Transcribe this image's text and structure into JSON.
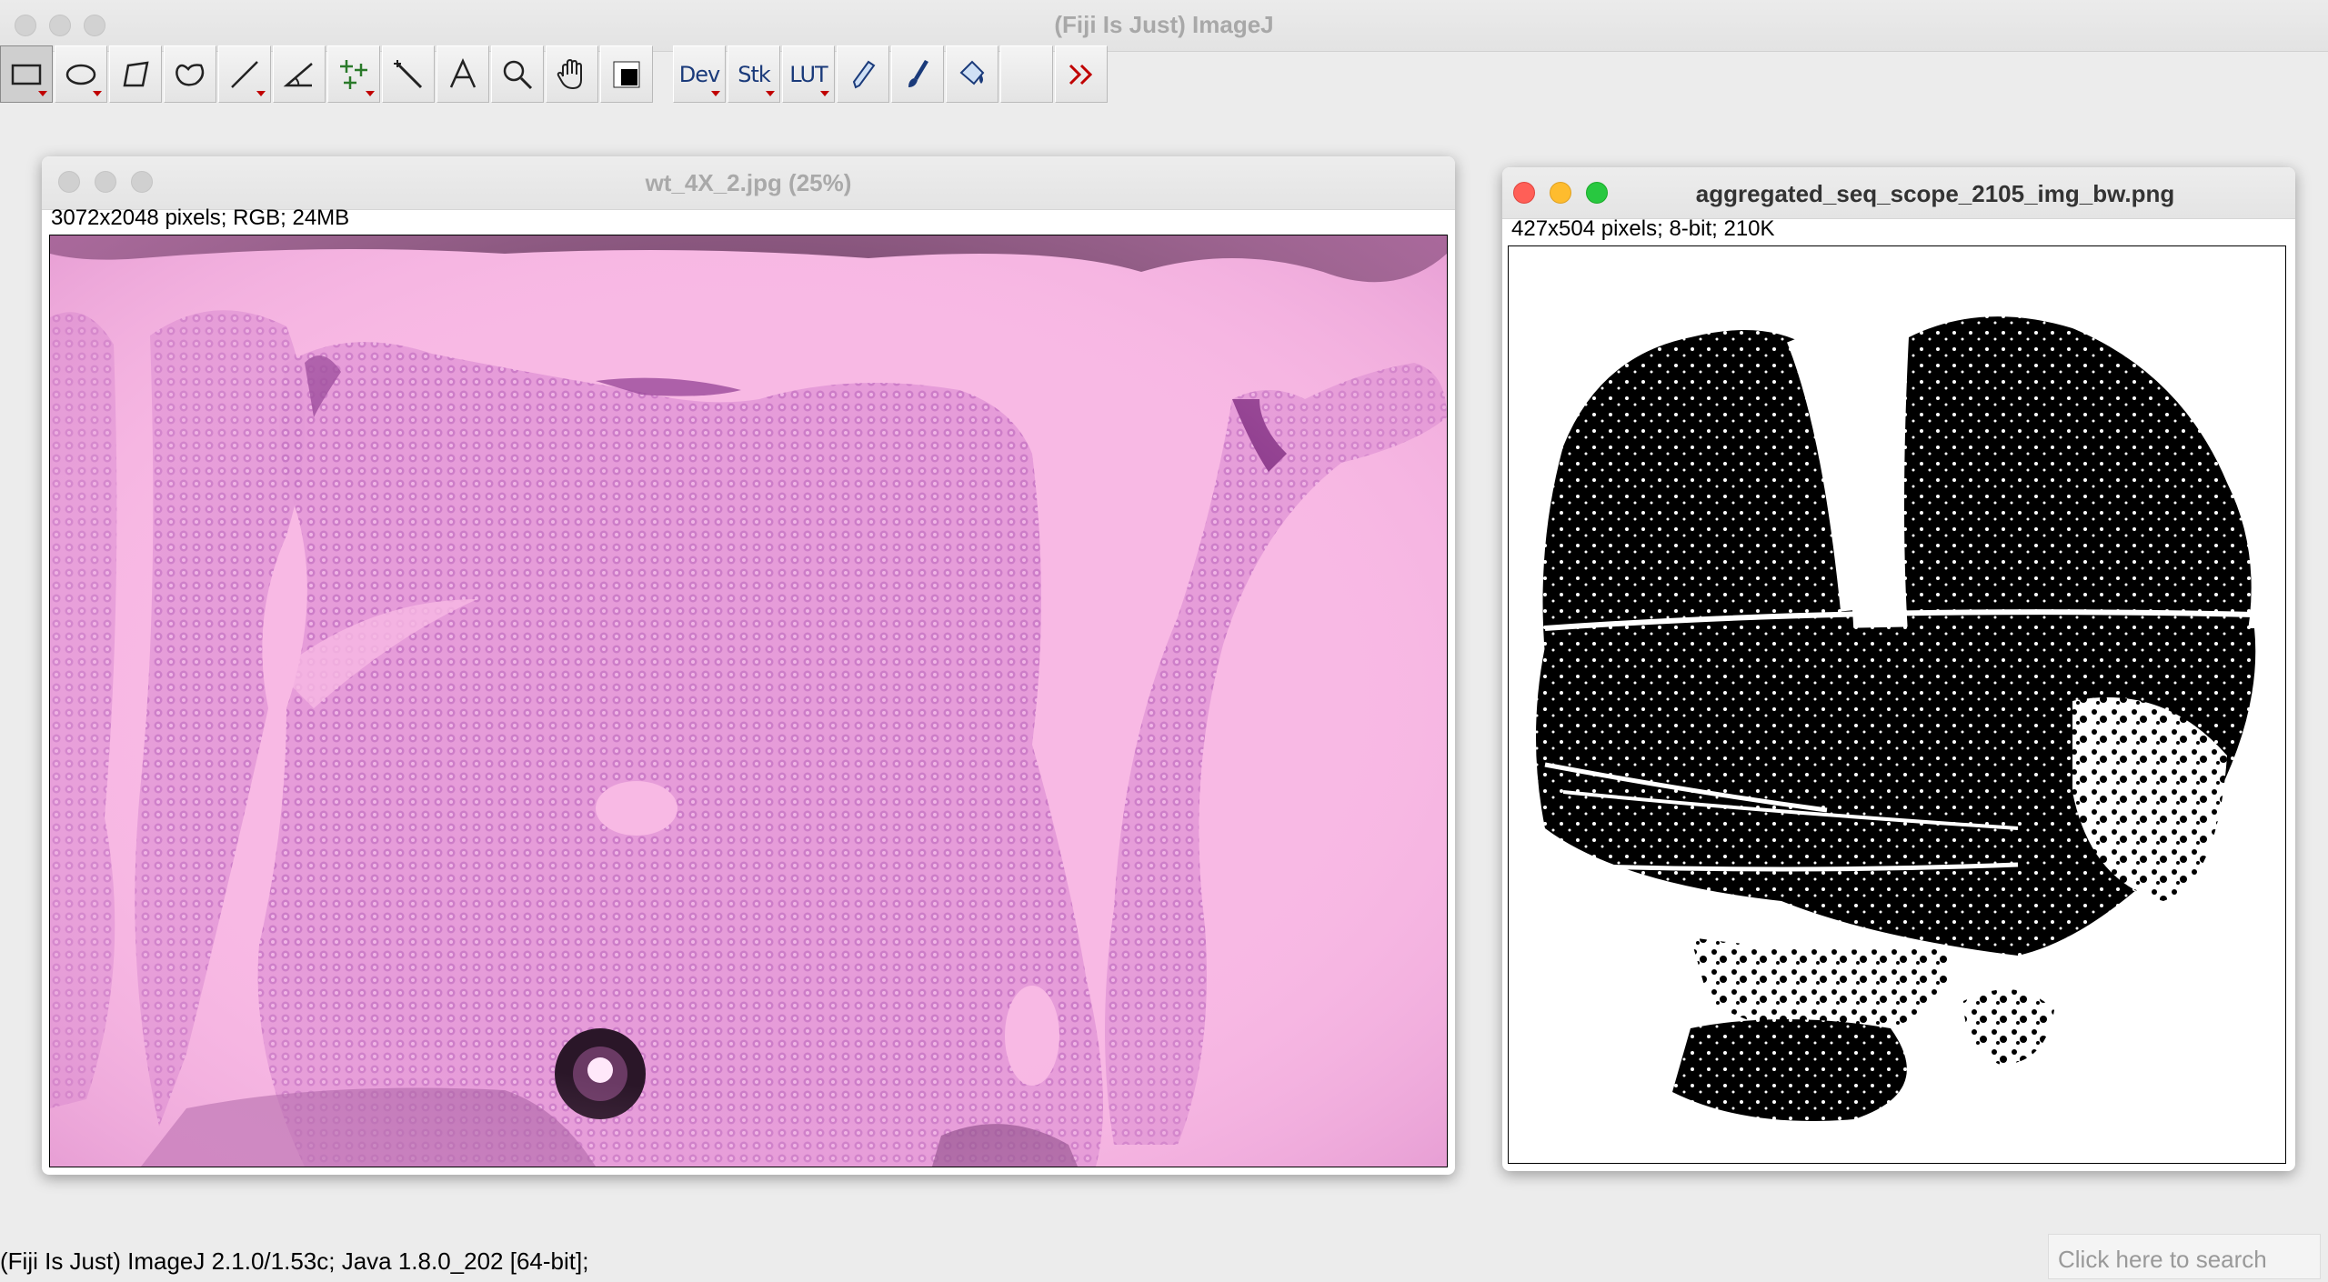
{
  "app": {
    "title": "(Fiji Is Just) ImageJ"
  },
  "toolbar": {
    "tools": [
      {
        "name": "rectangle-tool-icon",
        "selected": true
      },
      {
        "name": "oval-tool-icon"
      },
      {
        "name": "polygon-tool-icon"
      },
      {
        "name": "freehand-tool-icon"
      },
      {
        "name": "line-tool-icon"
      },
      {
        "name": "angle-tool-icon"
      },
      {
        "name": "multipoint-tool-icon"
      },
      {
        "name": "wand-tool-icon"
      },
      {
        "name": "text-tool-icon"
      },
      {
        "name": "magnifier-tool-icon"
      },
      {
        "name": "hand-tool-icon"
      },
      {
        "name": "color-picker-icon"
      }
    ],
    "dev_label": "Dev",
    "stk_label": "Stk",
    "lut_label": "LUT",
    "more_icon": "double-chevron-right-icon"
  },
  "window_left": {
    "title": "wt_4X_2.jpg (25%)",
    "info": "3072x2048 pixels; RGB; 24MB"
  },
  "window_right": {
    "title": "aggregated_seq_scope_2105_img_bw.png",
    "info": "427x504 pixels; 8-bit; 210K"
  },
  "status": {
    "text": "(Fiji Is Just) ImageJ 2.1.0/1.53c; Java 1.8.0_202 [64-bit];",
    "search_placeholder": "Click here to search"
  },
  "colors": {
    "tissue_pink": "#f3a8dc",
    "tissue_purple": "#b85ab8",
    "red_close": "#ff5f57",
    "yellow_min": "#febc2e",
    "green_max": "#28c840"
  }
}
